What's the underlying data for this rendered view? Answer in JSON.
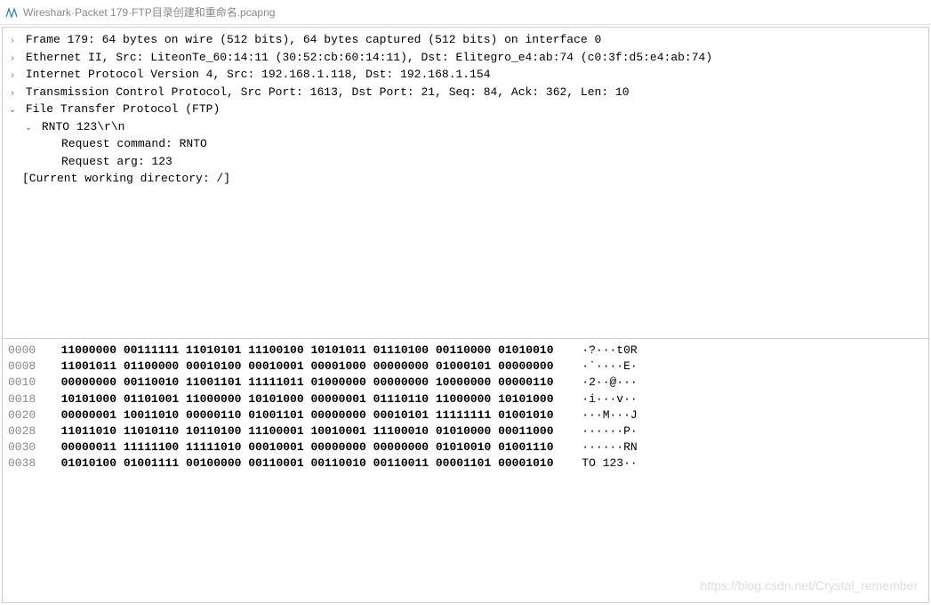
{
  "titlebar": {
    "app": "Wireshark",
    "separator1": " · ",
    "packet": "Packet 179",
    "separator2": " · ",
    "filename": "FTP目录创建和重命名.pcapng"
  },
  "tree": {
    "frame": "Frame 179: 64 bytes on wire (512 bits), 64 bytes captured (512 bits) on interface 0",
    "ethernet": "Ethernet II, Src: LiteonTe_60:14:11 (30:52:cb:60:14:11), Dst: Elitegro_e4:ab:74 (c0:3f:d5:e4:ab:74)",
    "ip": "Internet Protocol Version 4, Src: 192.168.1.118, Dst: 192.168.1.154",
    "tcp": "Transmission Control Protocol, Src Port: 1613, Dst Port: 21, Seq: 84, Ack: 362, Len: 10",
    "ftp": "File Transfer Protocol (FTP)",
    "rnto": "RNTO 123\\r\\n",
    "req_cmd": "Request command: RNTO",
    "req_arg": "Request arg: 123",
    "cwd": "[Current working directory: /]"
  },
  "hex": {
    "rows": [
      {
        "offset": "0000",
        "bytes": "11000000 00111111 11010101 11100100 10101011 01110100 00110000 01010010",
        "ascii": " ·?···t0R"
      },
      {
        "offset": "0008",
        "bytes": "11001011 01100000 00010100 00010001 00001000 00000000 01000101 00000000",
        "ascii": " ·`····E·"
      },
      {
        "offset": "0010",
        "bytes": "00000000 00110010 11001101 11111011 01000000 00000000 10000000 00000110",
        "ascii": " ·2··@···"
      },
      {
        "offset": "0018",
        "bytes": "10101000 01101001 11000000 10101000 00000001 01110110 11000000 10101000",
        "ascii": " ·i···v··"
      },
      {
        "offset": "0020",
        "bytes": "00000001 10011010 00000110 01001101 00000000 00010101 11111111 01001010",
        "ascii": " ···M···J"
      },
      {
        "offset": "0028",
        "bytes": "11011010 11010110 10110100 11100001 10010001 11100010 01010000 00011000",
        "ascii": " ······P·"
      },
      {
        "offset": "0030",
        "bytes": "00000011 11111100 11111010 00010001 00000000 00000000 01010010 01001110",
        "ascii": " ······RN"
      },
      {
        "offset": "0038",
        "bytes": "01010100 01001111 00100000 00110001 00110010 00110011 00001101 00001010",
        "ascii": " TO 123··"
      }
    ]
  },
  "watermark": "https://blog.csdn.net/Crystal_remember"
}
